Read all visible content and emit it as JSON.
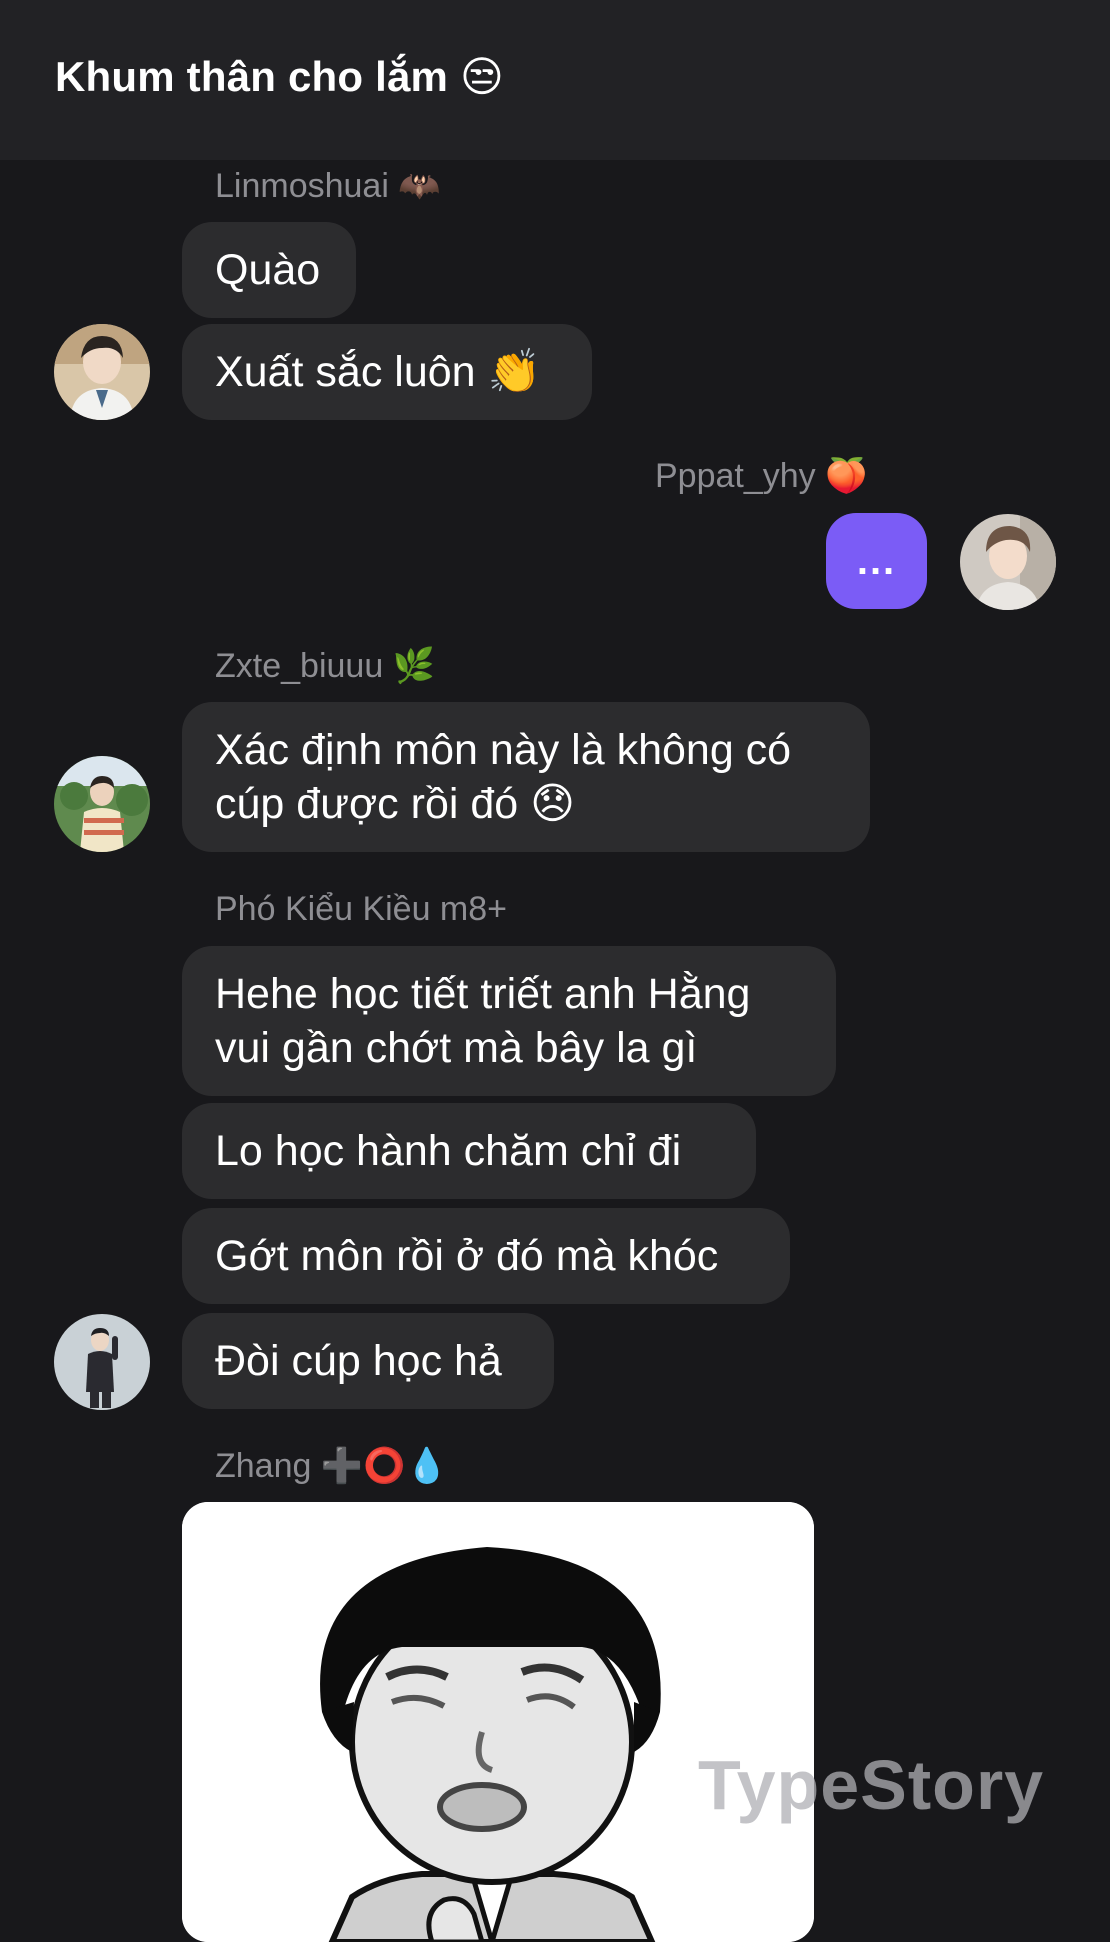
{
  "header": {
    "title": "Khum thân cho lắm 😒"
  },
  "messages": [
    {
      "sender": "Linmoshuai 🦇",
      "bubbles": [
        "Quào",
        "Xuất sắc luôn 👏"
      ]
    },
    {
      "sender": "Pppat_yhy 🍑",
      "bubbles": [
        "..."
      ]
    },
    {
      "sender": "Zxte_biuuu 🌿",
      "bubbles": [
        "Xác định môn này là không có cúp được rồi đó 😞"
      ]
    },
    {
      "sender": "Phó Kiểu Kiều m8+",
      "bubbles": [
        "Hehe học tiết triết anh Hằng vui gần chớt mà bây la gì",
        "Lo học hành chăm chỉ đi",
        "Gớt môn rồi ở đó mà khóc",
        "Đòi cúp học hả"
      ]
    },
    {
      "sender": "Zhang ➕⭕💧",
      "bubbles": []
    }
  ],
  "watermark": "TypeStory",
  "colors": {
    "background": "#18181b",
    "header": "#222225",
    "bubble_other": "#2c2c2e",
    "bubble_me": "#7b5cf6",
    "sender_name": "#8e8e93"
  }
}
